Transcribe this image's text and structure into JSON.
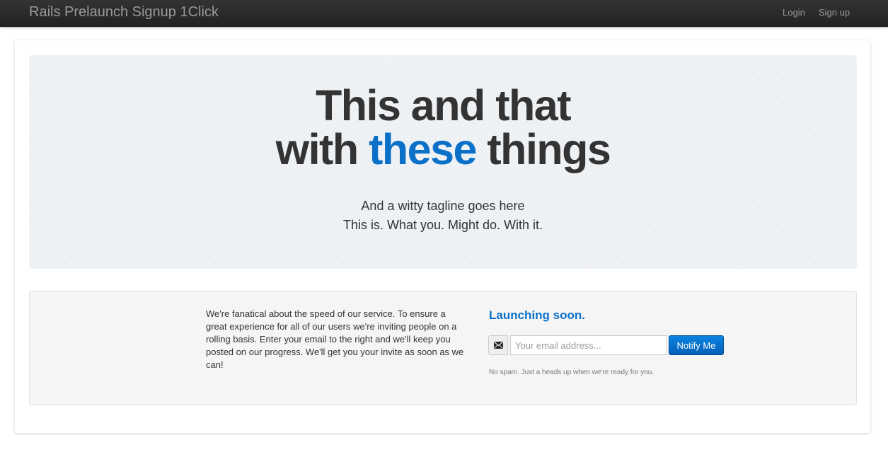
{
  "navbar": {
    "brand": "Rails Prelaunch Signup 1Click",
    "links": [
      "Login",
      "Sign up"
    ]
  },
  "hero": {
    "title_line1": "This and that",
    "title_line2_before": "with ",
    "title_line2_accent": "these",
    "title_line2_after": " things",
    "tagline_line1": "And a witty tagline goes here",
    "tagline_line2": "This is. What you. Might do. With it."
  },
  "signup": {
    "pitch": "We're fanatical about the speed of our service. To ensure a great experience for all of our users we're inviting people on a rolling basis. Enter your email to the right and we'll keep you posted on our progress. We'll get you your invite as soon as we can!",
    "heading": "Launching soon.",
    "email_placeholder": "Your email address...",
    "email_value": "",
    "email_icon": "envelope-icon",
    "button_label": "Notify Me",
    "note": "No spam. Just a heads up when we're ready for you."
  },
  "colors": {
    "accent": "#0a70c8",
    "navbar": "#222222",
    "button": "#0a6fd0"
  }
}
